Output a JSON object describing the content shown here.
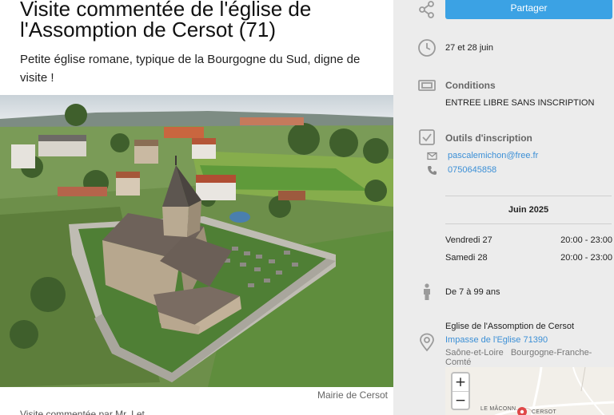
{
  "event": {
    "title": "Visite commentée de l'église de l'Assomption de Cersot (71)",
    "subtitle": "Petite église romane, typique de la Bourgogne du Sud, digne de visite !",
    "photo_credit": "Mairie de Cersot",
    "bottom_text": "Visite commentée par Mr. Let..."
  },
  "sidebar": {
    "share_label": "Partager",
    "dates_summary": "27 et 28 juin",
    "conditions": {
      "heading": "Conditions",
      "text": "ENTREE LIBRE SANS INSCRIPTION"
    },
    "registration": {
      "heading": "Outils d'inscription",
      "email": "pascalemichon@free.fr",
      "phone": "0750645858"
    },
    "schedule": {
      "month": "Juin 2025",
      "rows": [
        {
          "day": "Vendredi 27",
          "time": "20:00 - 23:00"
        },
        {
          "day": "Samedi 28",
          "time": "20:00 - 23:00"
        }
      ]
    },
    "age": "De 7 à 99 ans",
    "location": {
      "name": "Eglise de l'Assomption de Cersot",
      "street": "Impasse de l'Eglise 71390",
      "department": "Saône-et-Loire",
      "region": "Bourgogne-Franche-Comté"
    },
    "map": {
      "zoom_in": "+",
      "zoom_out": "−",
      "label_a": "LE MÂCONN...",
      "label_b": "CERSOT"
    }
  },
  "icons": {
    "share": "share-icon",
    "clock": "clock-icon",
    "ticket": "ticket-icon",
    "checkbox": "checkbox-icon",
    "email": "envelope-icon",
    "phone": "phone-icon",
    "person": "person-icon",
    "location": "map-pin-icon"
  },
  "colors": {
    "accent": "#3ba2e4",
    "link": "#3b8fd6",
    "sidebar_bg": "#ececec"
  }
}
